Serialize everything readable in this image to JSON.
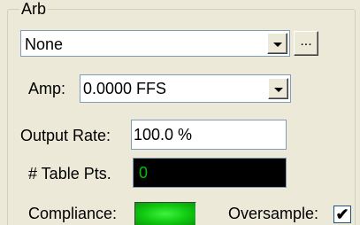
{
  "group": {
    "title": "Arb"
  },
  "arb_select": {
    "value": "None",
    "browse_label": "..."
  },
  "amp": {
    "label": "Amp:",
    "value": "0.0000 FFS"
  },
  "output_rate": {
    "label": "Output Rate:",
    "value": "100.0 %"
  },
  "table_pts": {
    "label": "# Table Pts.",
    "value": "0"
  },
  "compliance": {
    "label": "Compliance:",
    "led_color": "#12d012"
  },
  "oversample": {
    "label": "Oversample:",
    "checked": true,
    "check_glyph": "✔"
  },
  "colors": {
    "panel_bg": "#ece9d8",
    "field_border": "#7f9db9",
    "readout_text": "#00c000"
  }
}
